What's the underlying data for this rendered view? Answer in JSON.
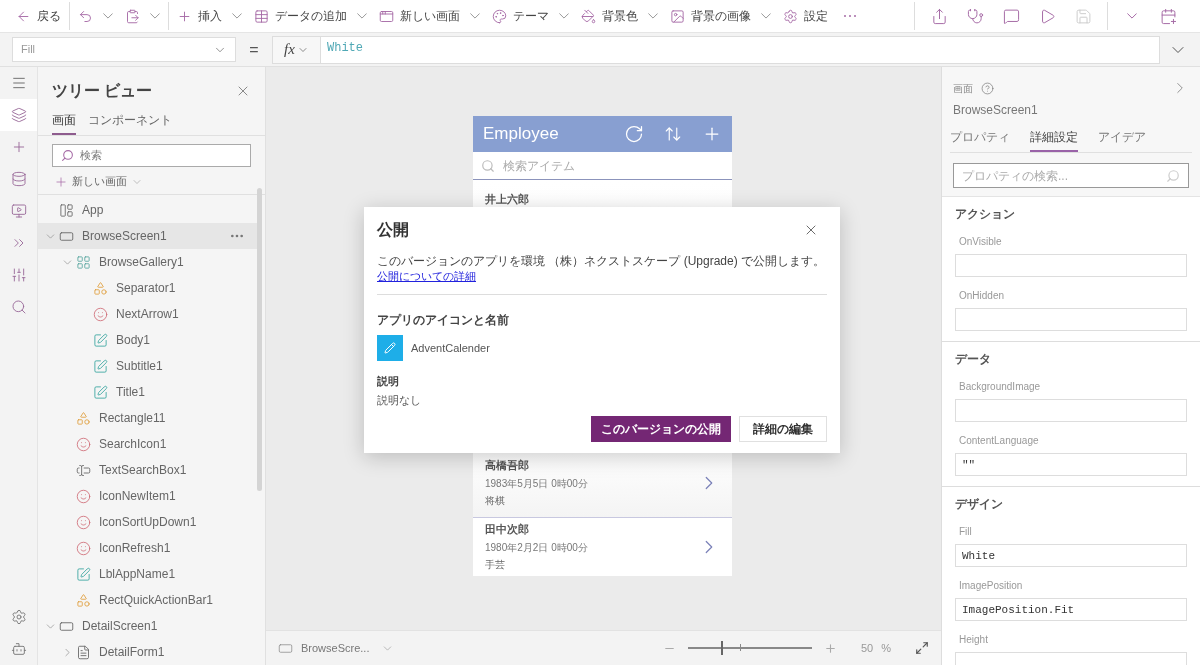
{
  "toolbar": {
    "groups": [
      [
        {
          "kind": "back",
          "label": "戻る",
          "dropdown": false
        }
      ],
      [
        {
          "kind": "undo",
          "dropdown": true
        },
        {
          "kind": "paste",
          "dropdown": true
        }
      ],
      [
        {
          "kind": "insert",
          "label": "挿入",
          "dropdown": true
        },
        {
          "kind": "data",
          "label": "データの追加",
          "dropdown": true
        },
        {
          "kind": "new_screen",
          "label": "新しい画面",
          "dropdown": true
        },
        {
          "kind": "theme",
          "label": "テーマ",
          "dropdown": true
        },
        {
          "kind": "bg_color",
          "label": "背景色",
          "dropdown": true
        },
        {
          "kind": "bg_image",
          "label": "背景の画像",
          "dropdown": true
        },
        {
          "kind": "settings",
          "label": "設定",
          "dropdown": false
        },
        {
          "kind": "more",
          "dropdown": false
        }
      ]
    ],
    "right_groups": [
      [
        {
          "kind": "share",
          "disabled": false
        },
        {
          "kind": "health",
          "disabled": false
        },
        {
          "kind": "comment",
          "disabled": false
        },
        {
          "kind": "play",
          "disabled": false
        },
        {
          "kind": "save",
          "disabled": true
        }
      ],
      [
        {
          "kind": "chevron",
          "disabled": false
        },
        {
          "kind": "publish",
          "disabled": false
        }
      ]
    ]
  },
  "formula_bar": {
    "property": "Fill",
    "operator": "=",
    "fx": "fx",
    "value": "White"
  },
  "rail": {
    "top": [
      {
        "kind": "menu",
        "selected": false
      },
      {
        "kind": "layers",
        "selected": true
      },
      {
        "kind": "insert",
        "selected": false
      },
      {
        "kind": "data",
        "selected": false
      },
      {
        "kind": "media",
        "selected": false
      },
      {
        "kind": "automate",
        "selected": false
      },
      {
        "kind": "tools",
        "selected": false
      },
      {
        "kind": "search",
        "selected": false
      }
    ],
    "bottom": [
      {
        "kind": "settings",
        "selected": false
      },
      {
        "kind": "bot",
        "selected": false
      }
    ]
  },
  "tree_view": {
    "title": "ツリー ビュー",
    "tabs": [
      {
        "label": "画面",
        "selected": true
      },
      {
        "label": "コンポーネント",
        "selected": false
      }
    ],
    "search": {
      "placeholder": "検索"
    },
    "new_screen": "新しい画面",
    "items": [
      {
        "label": "App",
        "kind": "app",
        "selected": false
      },
      {
        "label": "BrowseScreen1",
        "kind": "screen",
        "selected": true,
        "expanded": true,
        "children": [
          {
            "label": "BrowseGallery1",
            "kind": "gallery",
            "selected": false,
            "expanded": true,
            "children": [
              {
                "label": "Separator1",
                "kind": "shape",
                "selected": false
              },
              {
                "label": "NextArrow1",
                "kind": "icon",
                "selected": false
              },
              {
                "label": "Body1",
                "kind": "label",
                "selected": false
              },
              {
                "label": "Subtitle1",
                "kind": "label",
                "selected": false
              },
              {
                "label": "Title1",
                "kind": "label",
                "selected": false
              }
            ]
          },
          {
            "label": "Rectangle11",
            "kind": "shape",
            "selected": false
          },
          {
            "label": "SearchIcon1",
            "kind": "icon",
            "selected": false
          },
          {
            "label": "TextSearchBox1",
            "kind": "textinput",
            "selected": false
          },
          {
            "label": "IconNewItem1",
            "kind": "icon",
            "selected": false
          },
          {
            "label": "IconSortUpDown1",
            "kind": "icon",
            "selected": false
          },
          {
            "label": "IconRefresh1",
            "kind": "icon",
            "selected": false
          },
          {
            "label": "LblAppName1",
            "kind": "label",
            "selected": false
          },
          {
            "label": "RectQuickActionBar1",
            "kind": "shape",
            "selected": false
          }
        ]
      },
      {
        "label": "DetailScreen1",
        "kind": "screen",
        "selected": false,
        "expanded": true,
        "children": [
          {
            "label": "DetailForm1",
            "kind": "form",
            "selected": false,
            "expanded": false
          }
        ]
      }
    ]
  },
  "app_preview": {
    "title": "Employee",
    "search": {
      "placeholder": "検索アイテム"
    },
    "rows": [
      {
        "kind": "partial",
        "name": "井上六郎"
      },
      {
        "kind": "full",
        "name": "高橋吾郎",
        "date": "1983年5月5日 0時00分",
        "hobby": "将棋"
      },
      {
        "kind": "full",
        "name": "田中次郎",
        "date": "1980年2月2日 0時00分",
        "hobby": "手芸"
      }
    ]
  },
  "publish_dialog": {
    "title": "公開",
    "message": "このバージョンのアプリを環境 （株）ネクストスケープ (Upgrade) で公開します。",
    "link": "公開についての詳細",
    "icon_section": "アプリのアイコンと名前",
    "app_name": "AdventCalender",
    "description_label": "説明",
    "description": "説明なし",
    "buttons": [
      {
        "label": "このバージョンの公開",
        "kind": "primary"
      },
      {
        "label": "詳細の編集",
        "kind": "secondary"
      }
    ]
  },
  "properties": {
    "type_label": "画面",
    "name": "BrowseScreen1",
    "tabs": [
      {
        "label": "プロパティ",
        "selected": false
      },
      {
        "label": "詳細設定",
        "selected": true
      },
      {
        "label": "アイデア",
        "selected": false
      }
    ],
    "search": {
      "placeholder": "プロパティの検索..."
    },
    "sections": [
      {
        "title": "アクション",
        "fields": [
          {
            "label": "OnVisible"
          },
          {
            "label": "OnHidden"
          }
        ]
      },
      {
        "title": "データ",
        "fields": [
          {
            "label": "BackgroundImage"
          },
          {
            "label": "ContentLanguage",
            "value": "\"\""
          }
        ]
      },
      {
        "title": "デザイン",
        "fields": [
          {
            "label": "Fill",
            "value": "White"
          },
          {
            "label": "ImagePosition",
            "value": "ImagePosition.Fit"
          },
          {
            "label": "Height"
          }
        ]
      }
    ]
  },
  "status_bar": {
    "screen": "BrowseScre...",
    "zoom": {
      "level": 0.27,
      "value": "50",
      "unit": "%"
    }
  }
}
